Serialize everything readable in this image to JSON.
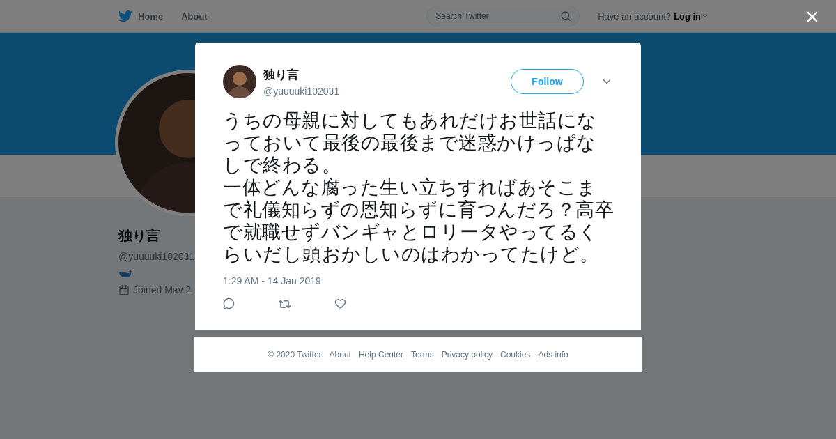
{
  "nav": {
    "items": [
      "Home",
      "About"
    ],
    "search": {
      "placeholder": "Search Twitter"
    },
    "account_prompt": "Have an account?",
    "login": "Log in"
  },
  "profile": {
    "name": "独り言",
    "handle": "@yuuuuki102031",
    "joined": "Joined May 2"
  },
  "tweet": {
    "name": "独り言",
    "handle": "@yuuuuki102031",
    "follow": "Follow",
    "paragraphs": [
      "うちの母親に対してもあれだけお世話になっておいて最後の最後まで迷惑かけっぱなしで終わる。",
      "一体どんな腐った生い立ちすればあそこまで礼儀知らずの恩知らずに育つんだろ？高卒で就職せずバンギャとロリータやってるくらいだし頭おかしいのはわかってたけど。"
    ],
    "time": "1:29 AM - 14 Jan 2019"
  },
  "footer": [
    "© 2020 Twitter",
    "About",
    "Help Center",
    "Terms",
    "Privacy policy",
    "Cookies",
    "Ads info"
  ]
}
